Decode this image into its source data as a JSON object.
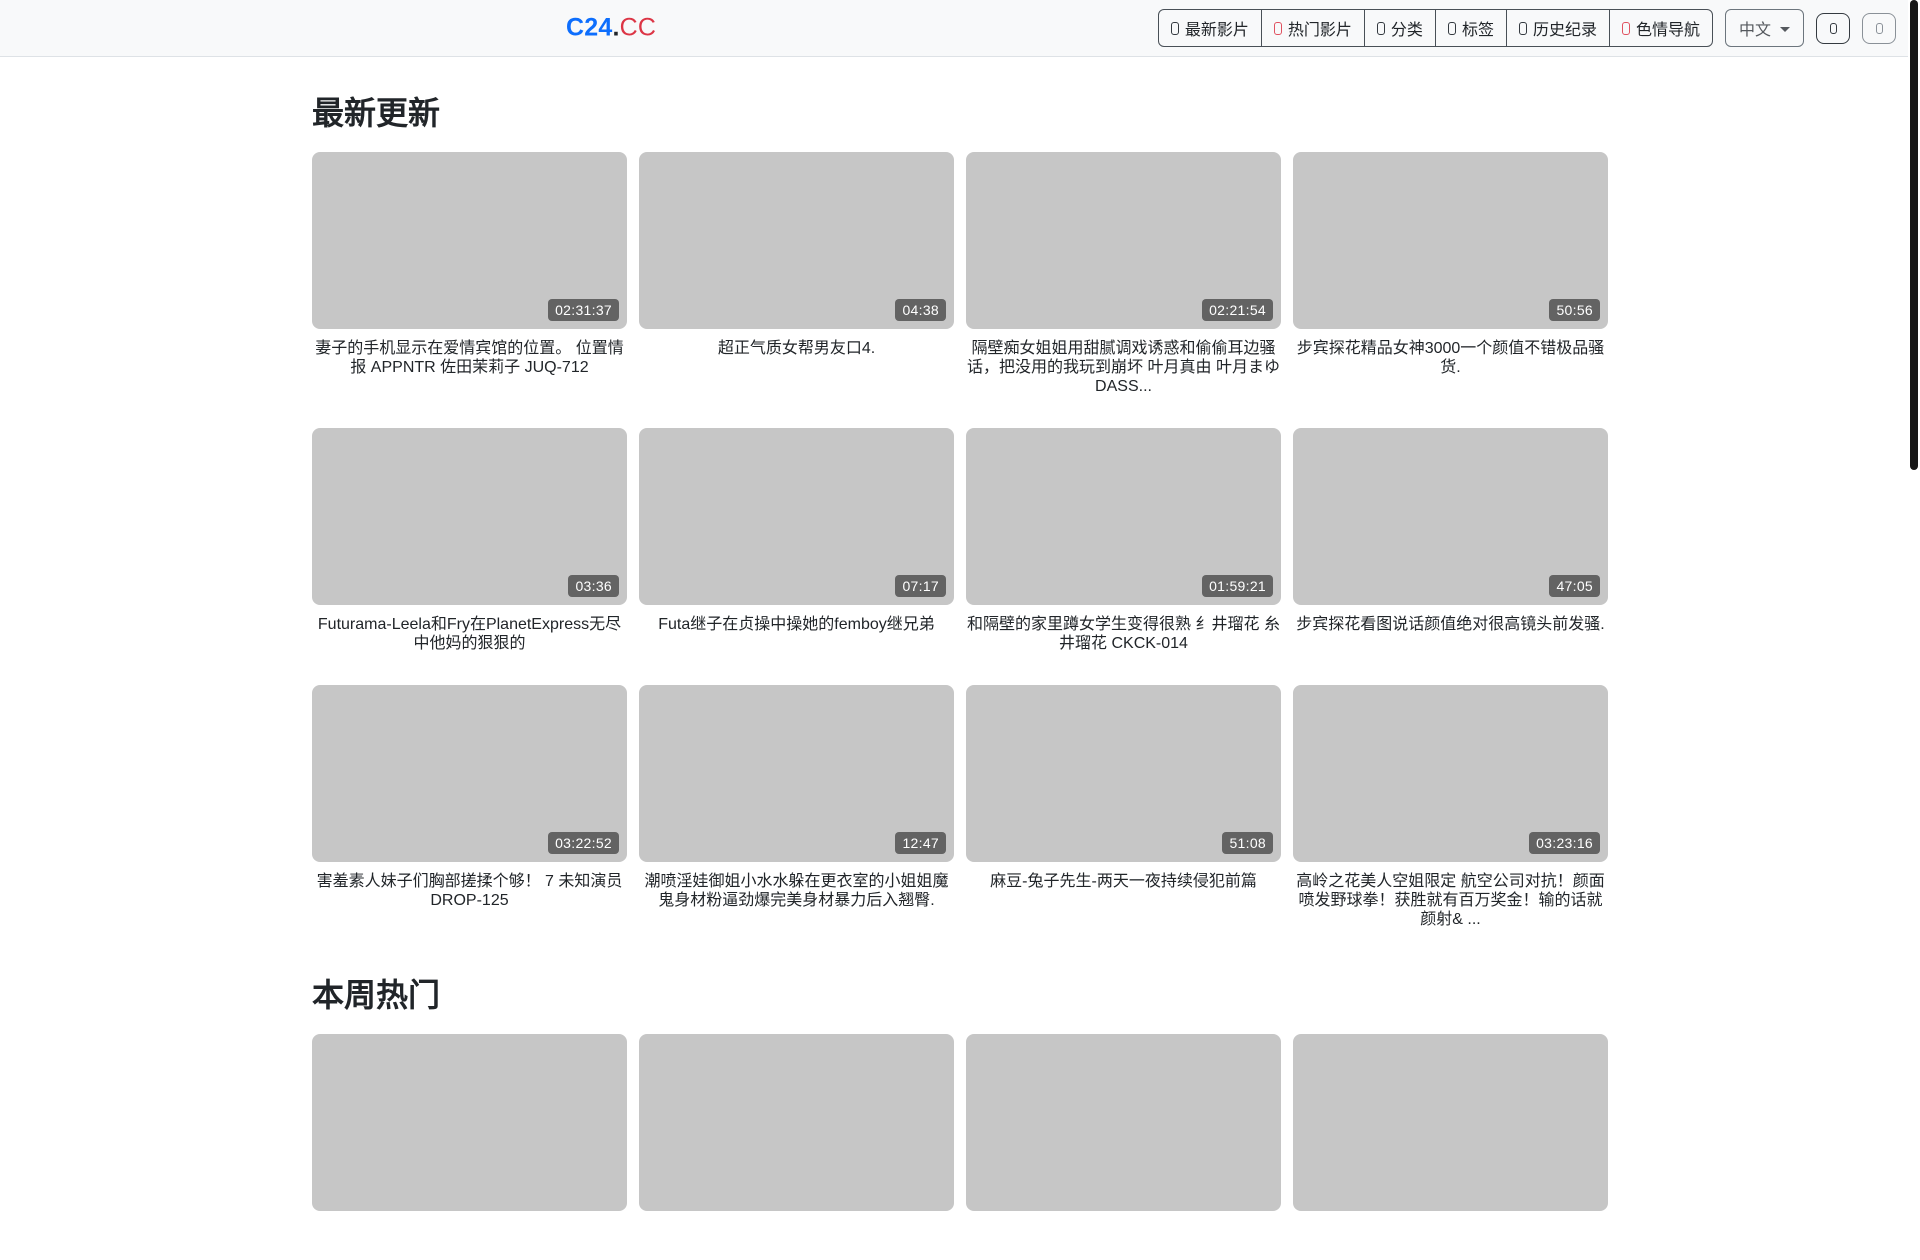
{
  "brand": {
    "blue": "C24",
    "dot": ".",
    "red": "CC"
  },
  "navbar": {
    "menu": [
      {
        "label": "最新影片",
        "icon": "film-icon",
        "color": "dark"
      },
      {
        "label": "热门影片",
        "icon": "fire-icon",
        "color": "red"
      },
      {
        "label": "分类",
        "icon": "category-icon",
        "color": "dark"
      },
      {
        "label": "标签",
        "icon": "tag-icon",
        "color": "dark"
      },
      {
        "label": "历史纪录",
        "icon": "history-icon",
        "color": "dark"
      },
      {
        "label": "色情导航",
        "icon": "compass-icon",
        "color": "red"
      }
    ],
    "language_button": {
      "label": "中文"
    }
  },
  "sections": [
    {
      "title": "最新更新",
      "videos": [
        {
          "duration": "02:31:37",
          "title": "妻子的手机显示在爱情宾馆的位置。 位置情报 APPNTR 佐田茉莉子 JUQ-712"
        },
        {
          "duration": "04:38",
          "title": "超正气质女帮男友口4."
        },
        {
          "duration": "02:21:54",
          "title": "隔壁痴女姐姐用甜腻调戏诱惑和偷偷耳边骚话，把没用的我玩到崩坏 叶月真由 叶月まゆ DASS..."
        },
        {
          "duration": "50:56",
          "title": "步宾探花精品女神3000一个颜值不错极品骚货."
        },
        {
          "duration": "03:36",
          "title": "Futurama-Leela和Fry在PlanetExpress无尽中他妈的狠狠的"
        },
        {
          "duration": "07:17",
          "title": "Futa继子在贞操中操她的femboy继兄弟"
        },
        {
          "duration": "01:59:21",
          "title": "和隔壁的家里蹲女学生变得很熟 纟井瑠花 糸井瑠花 CKCK-014"
        },
        {
          "duration": "47:05",
          "title": "步宾探花看图说话颜值绝对很高镜头前发骚."
        },
        {
          "duration": "03:22:52",
          "title": "害羞素人妹子们胸部搓揉个够！ 7 未知演员 DROP-125"
        },
        {
          "duration": "12:47",
          "title": "潮喷淫娃御姐小水水躲在更衣室的小姐姐魔鬼身材粉逼劲爆完美身材暴力后入翘臀."
        },
        {
          "duration": "51:08",
          "title": "麻豆-兔子先生-两天一夜持续侵犯前篇"
        },
        {
          "duration": "03:23:16",
          "title": "高岭之花美人空姐限定 航空公司对抗！颜面喷发野球拳！获胜就有百万奖金！输的话就颜射& ..."
        }
      ]
    },
    {
      "title": "本周热门",
      "videos": [
        {
          "duration": "",
          "title": ""
        },
        {
          "duration": "",
          "title": ""
        },
        {
          "duration": "",
          "title": ""
        },
        {
          "duration": "",
          "title": ""
        }
      ]
    }
  ],
  "colors": {
    "brand_blue": "#0d6efd",
    "brand_red": "#dc3545",
    "navbar_bg": "#f8f9fa",
    "thumbnail_bg": "#c6c6c6",
    "badge_bg": "#636363",
    "icon_red": "#e05260"
  }
}
